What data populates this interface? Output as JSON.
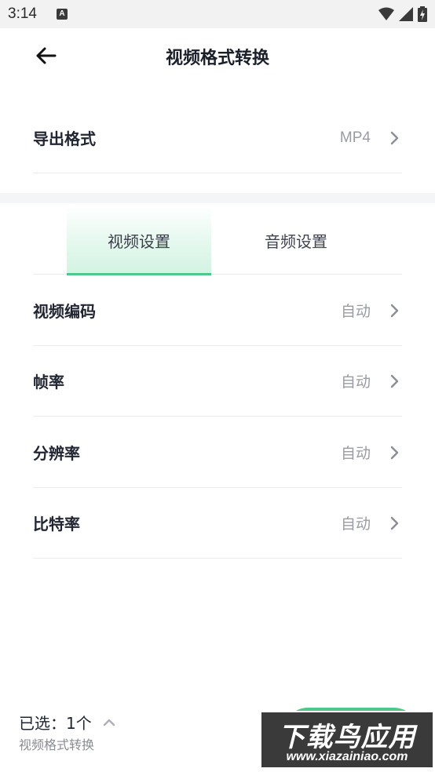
{
  "status_bar": {
    "time": "3:14",
    "notification_icon": "a-letter-icon",
    "icons": [
      "wifi-icon",
      "signal-icon",
      "battery-charging-icon"
    ]
  },
  "header": {
    "title": "视频格式转换",
    "back_icon": "arrow-left-icon"
  },
  "export_format": {
    "label": "导出格式",
    "value": "MP4"
  },
  "tabs": [
    {
      "label": "视频设置",
      "active": true
    },
    {
      "label": "音频设置",
      "active": false
    }
  ],
  "settings": [
    {
      "label": "视频编码",
      "value": "自动"
    },
    {
      "label": "帧率",
      "value": "自动"
    },
    {
      "label": "分辨率",
      "value": "自动"
    },
    {
      "label": "比特率",
      "value": "自动"
    }
  ],
  "bottom_bar": {
    "selected_text": "已选：1个",
    "subtitle": "视频格式转换"
  },
  "watermark": {
    "title": "下载鸟应用",
    "url": "www.xiazainiao.com"
  },
  "colors": {
    "accent": "#4cc98a",
    "tab_active_bg": "#d2f3e2",
    "text_primary": "#222633",
    "text_secondary": "#9a9ca3"
  }
}
